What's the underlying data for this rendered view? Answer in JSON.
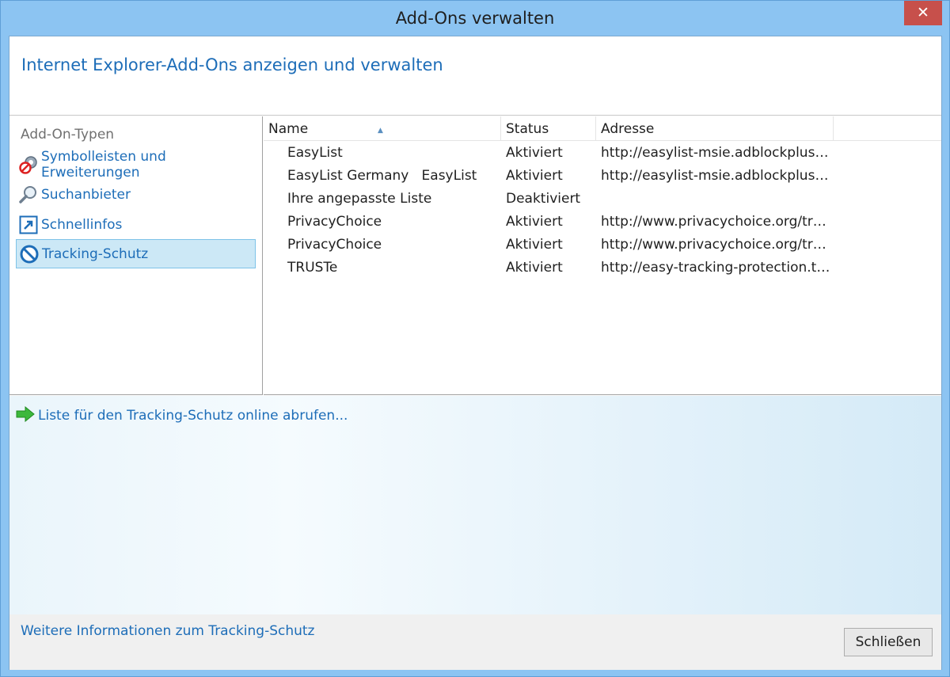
{
  "window": {
    "title": "Add-Ons verwalten",
    "close_glyph": "✕"
  },
  "header": {
    "title": "Internet Explorer-Add-Ons anzeigen und verwalten"
  },
  "sidebar": {
    "heading": "Add-On-Typen",
    "items": [
      {
        "label": "Symbolleisten und Erweiterungen",
        "icon": "gears-icon"
      },
      {
        "label": "Suchanbieter",
        "icon": "magnifier-icon"
      },
      {
        "label": "Schnellinfos",
        "icon": "accelerator-icon"
      },
      {
        "label": "Tracking-Schutz",
        "icon": "no-entry-icon",
        "selected": true
      }
    ]
  },
  "list": {
    "columns": [
      "Name",
      "Status",
      "Adresse"
    ],
    "sort_glyph": "▲",
    "rows": [
      {
        "name": "EasyList",
        "status": "Aktiviert",
        "address": "http://easylist-msie.adblockplus.or…"
      },
      {
        "name": "EasyList Germany   EasyList",
        "status": "Aktiviert",
        "address": "http://easylist-msie.adblockplus.or…"
      },
      {
        "name": "Ihre angepasste Liste",
        "status": "Deaktiviert",
        "address": ""
      },
      {
        "name": "PrivacyChoice",
        "status": "Aktiviert",
        "address": "http://www.privacychoice.org/trac…"
      },
      {
        "name": "PrivacyChoice",
        "status": "Aktiviert",
        "address": "http://www.privacychoice.org/trac…"
      },
      {
        "name": "TRUSTe",
        "status": "Aktiviert",
        "address": "http://easy-tracking-protection.tru…"
      }
    ]
  },
  "details": {
    "link_label": "Liste für den Tracking-Schutz online abrufen..."
  },
  "footer": {
    "info_link": "Weitere Informationen zum Tracking-Schutz",
    "close_label": "Schließen"
  },
  "colors": {
    "accent": "#1d6db8",
    "frame": "#8cc4f2",
    "close": "#c7504b",
    "selected": "#cce8f6"
  }
}
